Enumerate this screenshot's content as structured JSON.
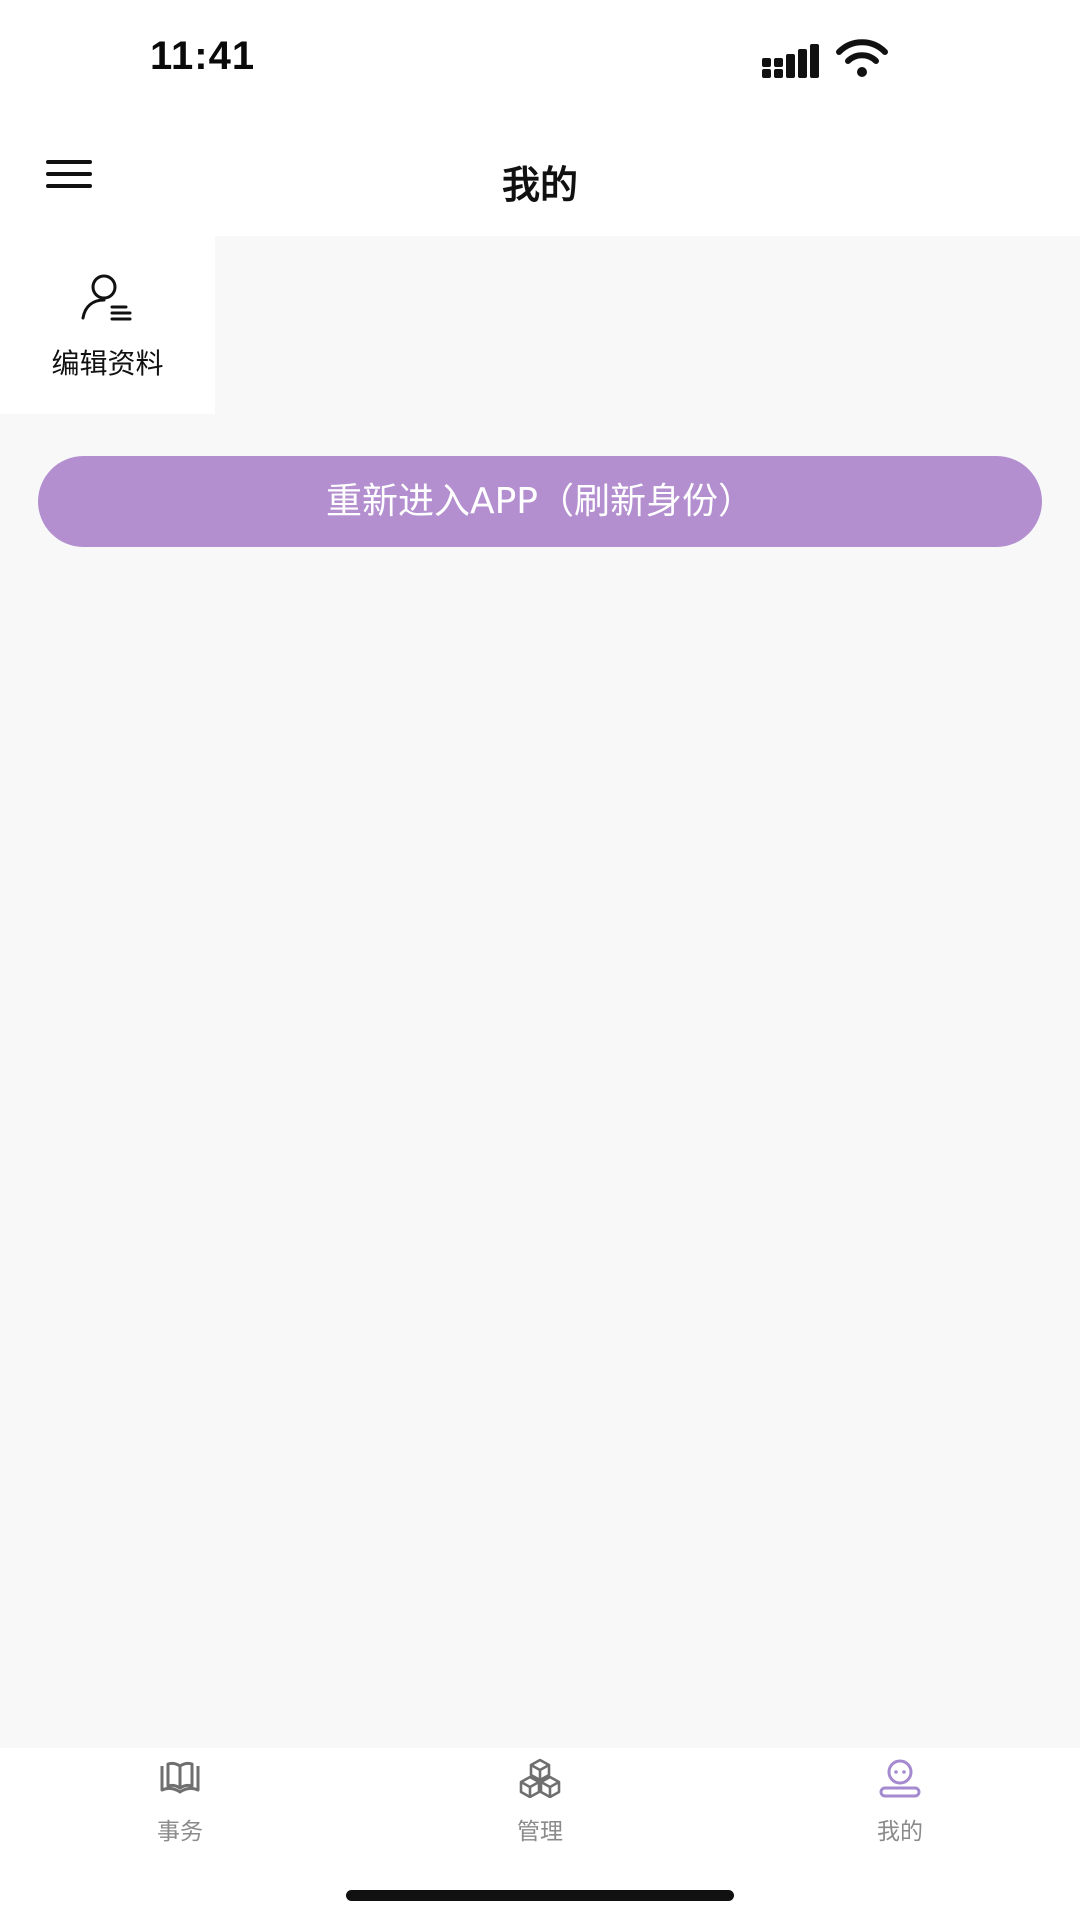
{
  "status_bar": {
    "time": "11:41",
    "icons": [
      "signal-icon",
      "wifi-icon"
    ]
  },
  "header": {
    "title": "我的",
    "menu_icon": "hamburger-menu-icon"
  },
  "quick_actions": [
    {
      "label": "编辑资料",
      "icon": "edit-profile-icon"
    }
  ],
  "primary_button": {
    "label": "重新进入APP（刷新身份）",
    "color": "#b38fd0"
  },
  "tab_bar": {
    "active_index": 2,
    "active_color": "#a58ad0",
    "tabs": [
      {
        "label": "事务",
        "icon": "open-book-icon"
      },
      {
        "label": "管理",
        "icon": "cubes-icon"
      },
      {
        "label": "我的",
        "icon": "profile-icon"
      }
    ]
  }
}
